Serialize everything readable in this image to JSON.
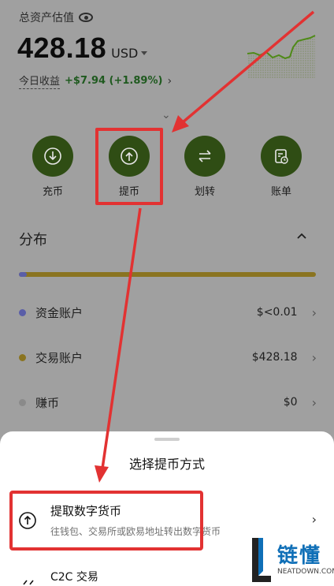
{
  "header": {
    "total_label": "总资产估值",
    "amount": "428.18",
    "currency": "USD",
    "today_label": "今日收益",
    "today_gain": "+$7.94 (+1.89%)"
  },
  "actions": [
    {
      "label": "充币",
      "icon": "deposit-icon"
    },
    {
      "label": "提币",
      "icon": "withdraw-icon"
    },
    {
      "label": "划转",
      "icon": "transfer-icon"
    },
    {
      "label": "账单",
      "icon": "bill-icon"
    }
  ],
  "distribution": {
    "title": "分布",
    "accounts": [
      {
        "name": "资金账户",
        "value": "$<0.01",
        "color": "#5a5ea8"
      },
      {
        "name": "交易账户",
        "value": "$428.18",
        "color": "#8a7420"
      },
      {
        "name": "赚币",
        "value": "$0",
        "color": "#8a8a8a"
      }
    ]
  },
  "sheet": {
    "title": "选择提币方式",
    "option1_title": "提取数字货币",
    "option1_desc": "往钱包、交易所或欧易地址转出数字货币",
    "option2_title": "C2C 交易"
  },
  "watermark": {
    "brand": "链懂",
    "site": "NEATDOWN.COM"
  },
  "colors": {
    "accent_green": "#2f4d14",
    "highlight_red": "#e23232"
  }
}
